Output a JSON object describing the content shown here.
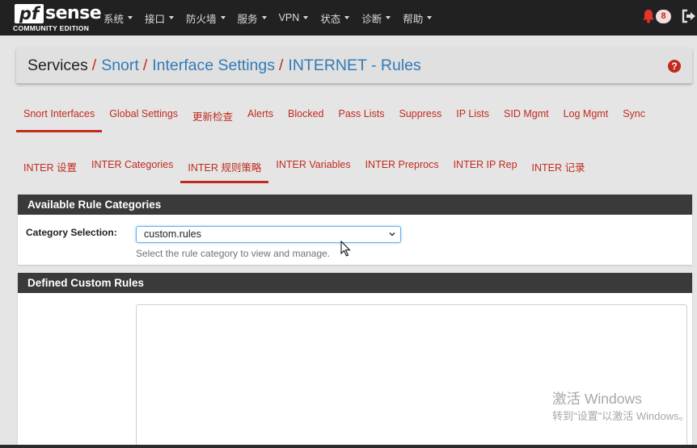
{
  "brand": {
    "logo_pf": "pf",
    "logo_sense": "sense",
    "edition": "COMMUNITY EDITION"
  },
  "nav": {
    "items": [
      {
        "label": "系统"
      },
      {
        "label": "接口"
      },
      {
        "label": "防火墙"
      },
      {
        "label": "服务"
      },
      {
        "label": "VPN"
      },
      {
        "label": "状态"
      },
      {
        "label": "诊断"
      },
      {
        "label": "帮助"
      }
    ],
    "notification_count": "8",
    "icons": {
      "notification": "bell-icon",
      "logout": "sign-out-icon"
    }
  },
  "breadcrumb": {
    "root": "Services",
    "separator": "/",
    "links": [
      "Snort",
      "Interface Settings",
      "INTERNET - Rules"
    ]
  },
  "tabs_primary": [
    {
      "label": "Snort Interfaces",
      "active": true
    },
    {
      "label": "Global Settings"
    },
    {
      "label": "更新检查"
    },
    {
      "label": "Alerts"
    },
    {
      "label": "Blocked"
    },
    {
      "label": "Pass Lists"
    },
    {
      "label": "Suppress"
    },
    {
      "label": "IP Lists"
    },
    {
      "label": "SID Mgmt"
    },
    {
      "label": "Log Mgmt"
    },
    {
      "label": "Sync"
    }
  ],
  "tabs_secondary": [
    {
      "label": "INTER 设置"
    },
    {
      "label": "INTER Categories"
    },
    {
      "label": "INTER 规则策略",
      "active": true
    },
    {
      "label": "INTER Variables"
    },
    {
      "label": "INTER Preprocs"
    },
    {
      "label": "INTER IP Rep"
    },
    {
      "label": "INTER 记录"
    }
  ],
  "rule_categories": {
    "heading": "Available Rule Categories",
    "field_label": "Category Selection:",
    "selected_value": "custom.rules",
    "help_text": "Select the rule category to view and manage."
  },
  "custom_rules": {
    "heading": "Defined Custom Rules",
    "content": ""
  },
  "watermark": {
    "line1": "激活 Windows",
    "line2": "转到\"设置\"以激活 Windows。"
  },
  "colors": {
    "accent": "#c12b1e",
    "link": "#337ab7",
    "navbar": "#212121",
    "panel_heading": "#3a3a3a"
  }
}
